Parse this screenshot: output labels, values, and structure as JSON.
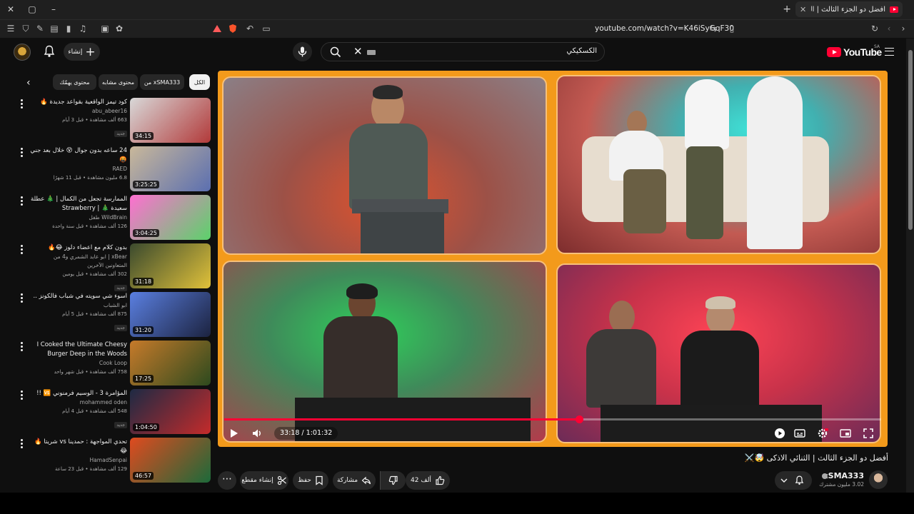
{
  "browser": {
    "tab_title": "افضل دو الجزء الثالث | الثنائي الاذكى",
    "url": "youtube.com/watch?v=K46iSyGqF30"
  },
  "masthead": {
    "create_label": "إنشاء",
    "search_value": "الكسكيكي",
    "logo_text": "YouTube",
    "region": "SA"
  },
  "chips": [
    "الكل",
    "من xSMA333",
    "محتوى مشابه",
    "محتوى يهمّك"
  ],
  "recommendations": [
    {
      "title": "كود تيمز الواقعية بقواعد جديدة 🔥",
      "channel": "abu_abeer16",
      "views": "663 ألف مشاهدة • قبل 3 أيام",
      "badge": "جديد",
      "duration": "34:15",
      "colors": [
        "#d8d8d8",
        "#b23a3a"
      ]
    },
    {
      "title": "24 ساعه بدون جوال 😵 خلال بعد جني 🤬",
      "channel": "RAED",
      "views": "6.8 مليون مشاهدة • قبل 11 شهرًا",
      "badge": "",
      "duration": "3:25:25",
      "colors": [
        "#c9b89a",
        "#5b6fb0"
      ]
    },
    {
      "title": "الممارسة تجعل من الكمال | 🎄 عطلة سعيدة 🎄 | Strawberry Shortcake | عر...",
      "channel": "WildBrain طفل",
      "views": "126 ألف مشاهدة • قبل سنة واحدة",
      "badge": "",
      "duration": "3:04:25",
      "colors": [
        "#ff6fd1",
        "#5bd26a"
      ]
    },
    {
      "title": "بدون كلام مع اعضاء دلوز 😂🔥",
      "channel": "xBear | ابو عابد الشمري و4 من المتعاونين الآخرين",
      "views": "302 ألف مشاهدة • قبل يومين",
      "badge": "جديد",
      "duration": "31:18",
      "colors": [
        "#3b4a2e",
        "#e0c13a"
      ]
    },
    {
      "title": "اسوء شي سويته في شباب فالكونز ..",
      "channel": "ابو الشباب",
      "views": "875 ألف مشاهدة • قبل 5 أيام",
      "badge": "جديد",
      "duration": "31:20",
      "colors": [
        "#5a7fe0",
        "#1c2340"
      ]
    },
    {
      "title": "I Cooked the Ultimate Cheesy Burger Deep in the Woods",
      "channel": "Cook Loop",
      "views": "758 ألف مشاهدة • قبل شهر واحد",
      "badge": "",
      "duration": "17:25",
      "colors": [
        "#c67a2a",
        "#2d4a1e"
      ]
    },
    {
      "title": "المؤامرة 3 - الوسيم فرمنوني 🆚 !!",
      "channel": "mohammed oden",
      "views": "548 ألف مشاهدة • قبل 4 أيام",
      "badge": "جديد",
      "duration": "1:04:50",
      "colors": [
        "#1d2a44",
        "#c42b2b"
      ]
    },
    {
      "title": "تحدي المواجهة : حمدينا vs شريتا 🔥😂",
      "channel": "HamadSenpai",
      "views": "129 ألف مشاهدة • قبل 23 ساعة",
      "badge": "",
      "duration": "46:57",
      "colors": [
        "#e04a1f",
        "#1c6a3a"
      ]
    }
  ],
  "player": {
    "current_time": "33:18",
    "duration": "1:01:32",
    "time_separator": "/",
    "progress_fraction": 0.54
  },
  "video": {
    "title": "أفضل دو الجزء الثالث | الثنائي الاذكى 🤯⚔️",
    "channel": "xSMA333",
    "subscribers": "3.02 مليون مشترك",
    "likes": "42 ألف",
    "share_label": "مشاركة",
    "save_label": "حفظ",
    "clip_label": "إنشاء مقطع"
  },
  "colors": {
    "accent": "#ff0033",
    "background": "#0f0f0f",
    "player_frame": "#f39a1b"
  }
}
